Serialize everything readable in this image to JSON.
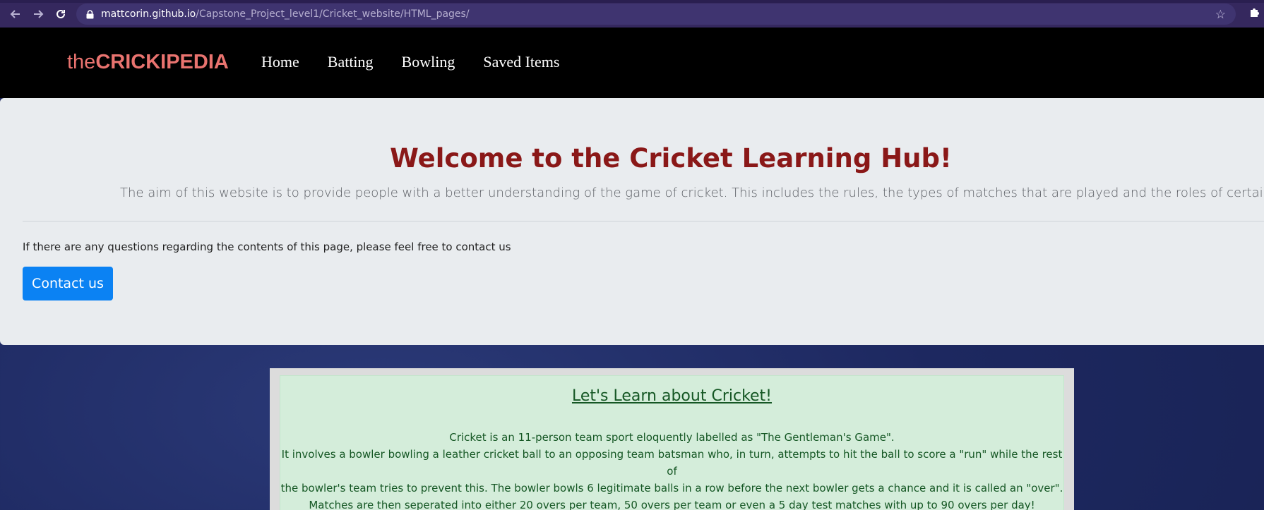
{
  "browser": {
    "url_host": "mattcorin.github.io",
    "url_path": "/Capstone_Project_level1/Cricket_website/HTML_pages/"
  },
  "nav": {
    "brand_prefix": "the",
    "brand_name": "CRICKIPEDIA",
    "links": [
      "Home",
      "Batting",
      "Bowling",
      "Saved Items"
    ]
  },
  "jumbotron": {
    "title": "Welcome to the Cricket Learning Hub!",
    "lead": "The aim of this website is to provide people with a better understanding of the game of cricket. This includes the rules, the types of matches that are played and the roles of certain players!",
    "contact_text": "If there are any questions regarding the contents of this page, please feel free to contact us",
    "contact_button": "Contact us"
  },
  "card": {
    "title": "Let's Learn about Cricket!",
    "lines": [
      "Cricket is an 11-person team sport eloquently labelled as \"The Gentleman's Game\".",
      "It involves a bowler bowling a leather cricket ball to an opposing team batsman who, in turn, attempts to hit the ball to score a \"run\" while the rest of",
      "the bowler's team tries to prevent this. The bowler bowls 6 legitimate balls in a row before the next bowler gets a chance and it is called an \"over\".",
      "Matches are then seperated into either 20 overs per team, 50 overs per team or even a 5 day test matches with up to 90 overs per day!"
    ]
  },
  "icons": {
    "back": "arrow-left-icon",
    "forward": "arrow-right-icon",
    "reload": "reload-icon",
    "lock": "lock-icon",
    "bookmark": "star-icon",
    "extensions": "puzzle-icon"
  },
  "colors": {
    "brand": "#e9736f",
    "title": "#8a1818",
    "button": "#0b82f3",
    "card_bg": "#d4edda",
    "card_text": "#155724"
  }
}
